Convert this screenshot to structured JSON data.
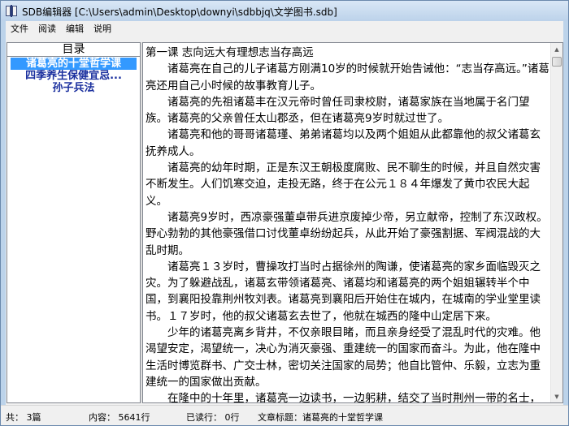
{
  "window": {
    "title": "SDB编辑器 [C:\\Users\\admin\\Desktop\\downyi\\sdbbjq\\文学图书.sdb]"
  },
  "menu": [
    "文件",
    "阅读",
    "编辑",
    "说明"
  ],
  "toc": {
    "header": "目录",
    "items": [
      {
        "label": "诸葛亮的十堂哲学课",
        "selected": true
      },
      {
        "label": "四季养生保健宜忌...",
        "selected": false
      },
      {
        "label": "孙子兵法",
        "selected": false
      }
    ]
  },
  "reader": {
    "paragraphs": [
      "第一课 志向远大有理想志当存高远",
      "诸葛亮在自己的儿子诸葛方刚满10岁的时候就开始告诫他：“志当存高远。”诸葛亮还用自己小时候的故事教育儿子。",
      "诸葛亮的先祖诸葛丰在汉元帝时曾任司隶校尉，诸葛家族在当地属于名门望族。诸葛亮的父亲曾任太山郡丞，但在诸葛亮9岁时就过世了。",
      "诸葛亮和他的哥哥诸葛瑾、弟弟诸葛均以及两个姐姐从此都靠他的叔父诸葛玄抚养成人。",
      "诸葛亮的幼年时期，正是东汉王朝极度腐败、民不聊生的时候，并且自然灾害不断发生。人们饥寒交迫，走投无路，终于在公元１８４年爆发了黄巾农民大起义。",
      "诸葛亮9岁时，西凉豪强董卓带兵进京废掉少帝，另立献帝，控制了东汉政权。野心勃勃的其他豪强借口讨伐董卓纷纷起兵，从此开始了豪强割据、军阀混战的大乱时期。",
      "诸葛亮１３岁时，曹操攻打当时占据徐州的陶谦，使诸葛亮的家乡面临毁灭之灾。为了躲避战乱，诸葛玄带领诸葛亮、诸葛均和诸葛亮的两个姐姐辗转半个中国，到襄阳投靠荆州牧刘表。诸葛亮到襄阳后开始住在城内，在城南的学业堂里读书。１７岁时，他的叔父诸葛玄去世了，他就在城西的隆中山定居下来。",
      "少年的诸葛亮离乡背井，不仅亲眼目睹，而且亲身经受了混乱时代的灾难。他渴望安定，渴望统一，决心为消灭豪强、重建统一的国家而奋斗。为此，他在隆中生活时博览群书、广交士林，密切关注国家的局势；他自比管仲、乐毅，立志为重建统一的国家做出贡献。",
      "在隆中的十年里，诸葛亮一边读书，一边躬耕，结交了当时荆州一带的名士，也积累了丰富的学识，为日后出山辅佐刘备打下了坚实的基础。"
    ]
  },
  "status": {
    "total": "共：  3篇",
    "content": "内容：  5641行",
    "read": "已读行：  0行",
    "article": "文章标题：诸葛亮的十堂哲学课"
  }
}
